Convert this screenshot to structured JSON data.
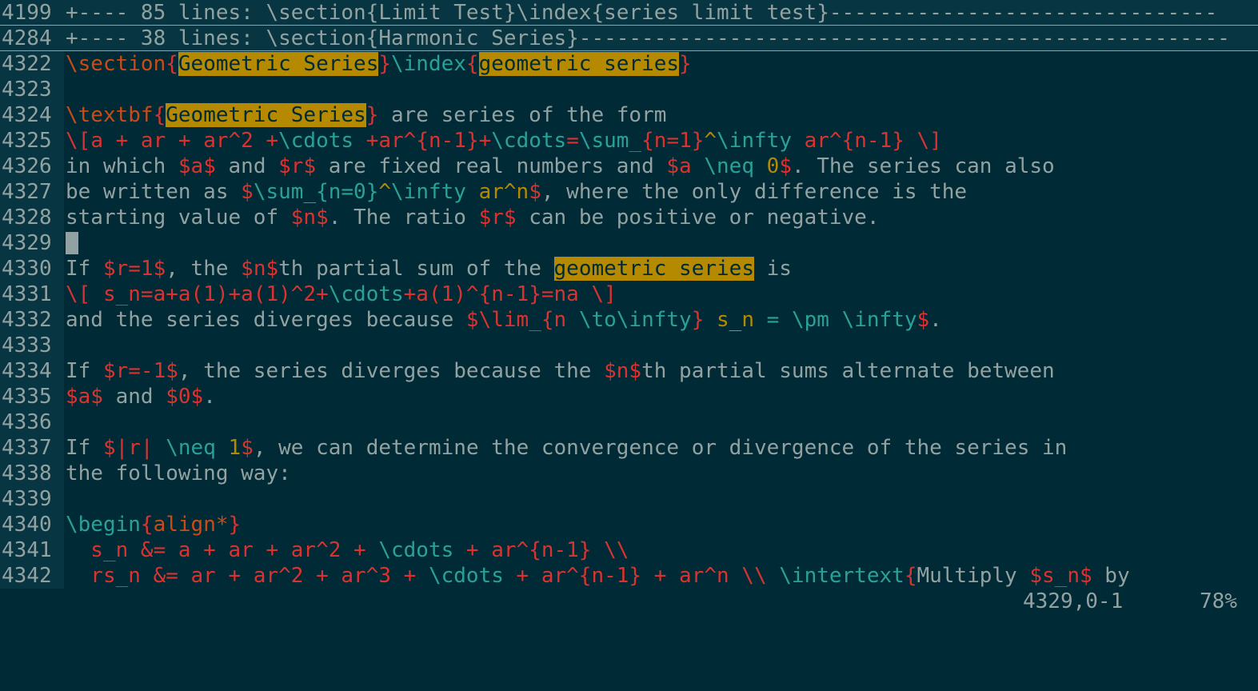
{
  "colors": {
    "background": "#002b36",
    "gutter": "#073642",
    "text": "#93a1a1",
    "red": "#dc322f",
    "cyan": "#2aa198",
    "orange": "#cb4b16",
    "yellow": "#b58900",
    "search_highlight": "#b58900"
  },
  "lines": [
    {
      "num": "4199",
      "fold": true,
      "segs": [
        {
          "t": "+---- 85 lines: \\section{Limit Test}\\index{series limit test}-------------------------------",
          "c": "fold"
        }
      ]
    },
    {
      "num": "4284",
      "fold": true,
      "segs": [
        {
          "t": "+---- 38 lines: \\section{Harmonic Series}----------------------------------------------------",
          "c": "fold"
        }
      ]
    },
    {
      "num": "4322",
      "segs": [
        {
          "t": "\\section",
          "c": "orange"
        },
        {
          "t": "{",
          "c": "red"
        },
        {
          "t": "Geometric Series",
          "c": "hl"
        },
        {
          "t": "}",
          "c": "red"
        },
        {
          "t": "\\index",
          "c": "cyan"
        },
        {
          "t": "{",
          "c": "red"
        },
        {
          "t": "geometric series",
          "c": "hl"
        },
        {
          "t": "}",
          "c": "red"
        }
      ]
    },
    {
      "num": "4323",
      "segs": []
    },
    {
      "num": "4324",
      "segs": [
        {
          "t": "\\textbf",
          "c": "orange"
        },
        {
          "t": "{",
          "c": "red"
        },
        {
          "t": "Geometric Series",
          "c": "hl"
        },
        {
          "t": "}",
          "c": "red"
        },
        {
          "t": " are series of the form",
          "c": "text"
        }
      ]
    },
    {
      "num": "4325",
      "segs": [
        {
          "t": "\\[",
          "c": "red"
        },
        {
          "t": "a + ar + ar^2 +",
          "c": "red"
        },
        {
          "t": "\\cdots",
          "c": "cyan"
        },
        {
          "t": " +ar^",
          "c": "red"
        },
        {
          "t": "{n-1}",
          "c": "red"
        },
        {
          "t": "+",
          "c": "red"
        },
        {
          "t": "\\cdots",
          "c": "cyan"
        },
        {
          "t": "=",
          "c": "red"
        },
        {
          "t": "\\sum",
          "c": "cyan"
        },
        {
          "t": "_{n=1}",
          "c": "red"
        },
        {
          "t": "^",
          "c": "yellow"
        },
        {
          "t": "\\infty",
          "c": "cyan"
        },
        {
          "t": " ar^",
          "c": "red"
        },
        {
          "t": "{n-1}",
          "c": "red"
        },
        {
          "t": " \\]",
          "c": "red"
        }
      ]
    },
    {
      "num": "4326",
      "segs": [
        {
          "t": "in which ",
          "c": "text"
        },
        {
          "t": "$a$",
          "c": "red"
        },
        {
          "t": " and ",
          "c": "text"
        },
        {
          "t": "$r$",
          "c": "red"
        },
        {
          "t": " are fixed real numbers and ",
          "c": "text"
        },
        {
          "t": "$a ",
          "c": "red"
        },
        {
          "t": "\\neq",
          "c": "cyan"
        },
        {
          "t": " 0",
          "c": "yellow"
        },
        {
          "t": "$",
          "c": "red"
        },
        {
          "t": ". The series can also",
          "c": "text"
        }
      ]
    },
    {
      "num": "4327",
      "segs": [
        {
          "t": "be written as ",
          "c": "text"
        },
        {
          "t": "$",
          "c": "red"
        },
        {
          "t": "\\sum",
          "c": "cyan"
        },
        {
          "t": "_{n=0}",
          "c": "cyan"
        },
        {
          "t": "^",
          "c": "yellow"
        },
        {
          "t": "\\infty",
          "c": "cyan"
        },
        {
          "t": " ar^n",
          "c": "yellow"
        },
        {
          "t": "$",
          "c": "red"
        },
        {
          "t": ", where the only difference is the",
          "c": "text"
        }
      ]
    },
    {
      "num": "4328",
      "segs": [
        {
          "t": "starting value of ",
          "c": "text"
        },
        {
          "t": "$n$",
          "c": "red"
        },
        {
          "t": ". The ratio ",
          "c": "text"
        },
        {
          "t": "$r$",
          "c": "red"
        },
        {
          "t": " can be positive or negative.",
          "c": "text"
        }
      ]
    },
    {
      "num": "4329",
      "cursor": true,
      "segs": []
    },
    {
      "num": "4330",
      "segs": [
        {
          "t": "If ",
          "c": "text"
        },
        {
          "t": "$r=1$",
          "c": "red"
        },
        {
          "t": ", the ",
          "c": "text"
        },
        {
          "t": "$n$",
          "c": "red"
        },
        {
          "t": "th partial sum of the ",
          "c": "text"
        },
        {
          "t": "geometric series",
          "c": "hl"
        },
        {
          "t": " is",
          "c": "text"
        }
      ]
    },
    {
      "num": "4331",
      "segs": [
        {
          "t": "\\[ s_n=a+a(1)+a(1)^2+",
          "c": "red"
        },
        {
          "t": "\\cdots",
          "c": "cyan"
        },
        {
          "t": "+a(1)^",
          "c": "red"
        },
        {
          "t": "{n-1}",
          "c": "red"
        },
        {
          "t": "=na \\]",
          "c": "red"
        }
      ]
    },
    {
      "num": "4332",
      "segs": [
        {
          "t": "and the series diverges because ",
          "c": "text"
        },
        {
          "t": "$",
          "c": "red"
        },
        {
          "t": "\\lim",
          "c": "red"
        },
        {
          "t": "_{n ",
          "c": "red"
        },
        {
          "t": "\\to",
          "c": "cyan"
        },
        {
          "t": "\\infty",
          "c": "cyan"
        },
        {
          "t": "}",
          "c": "red"
        },
        {
          "t": " s_n",
          "c": "yellow"
        },
        {
          "t": " = ",
          "c": "cyan"
        },
        {
          "t": "\\pm",
          "c": "cyan"
        },
        {
          "t": " ",
          "c": "text"
        },
        {
          "t": "\\infty",
          "c": "cyan"
        },
        {
          "t": "$",
          "c": "red"
        },
        {
          "t": ".",
          "c": "text"
        }
      ]
    },
    {
      "num": "4333",
      "segs": []
    },
    {
      "num": "4334",
      "segs": [
        {
          "t": "If ",
          "c": "text"
        },
        {
          "t": "$r=-1$",
          "c": "red"
        },
        {
          "t": ", the series diverges because the ",
          "c": "text"
        },
        {
          "t": "$n$",
          "c": "red"
        },
        {
          "t": "th partial sums alternate between",
          "c": "text"
        }
      ]
    },
    {
      "num": "4335",
      "segs": [
        {
          "t": "$a$",
          "c": "red"
        },
        {
          "t": " and ",
          "c": "text"
        },
        {
          "t": "$0$",
          "c": "red"
        },
        {
          "t": ".",
          "c": "text"
        }
      ]
    },
    {
      "num": "4336",
      "segs": []
    },
    {
      "num": "4337",
      "segs": [
        {
          "t": "If ",
          "c": "text"
        },
        {
          "t": "$|r| ",
          "c": "red"
        },
        {
          "t": "\\neq",
          "c": "cyan"
        },
        {
          "t": " 1",
          "c": "yellow"
        },
        {
          "t": "$",
          "c": "red"
        },
        {
          "t": ", we can determine the convergence or divergence of the series in",
          "c": "text"
        }
      ]
    },
    {
      "num": "4338",
      "segs": [
        {
          "t": "the following way:",
          "c": "text"
        }
      ]
    },
    {
      "num": "4339",
      "segs": []
    },
    {
      "num": "4340",
      "segs": [
        {
          "t": "\\begin",
          "c": "cyan"
        },
        {
          "t": "{",
          "c": "red"
        },
        {
          "t": "align*",
          "c": "orange"
        },
        {
          "t": "}",
          "c": "red"
        }
      ]
    },
    {
      "num": "4341",
      "segs": [
        {
          "t": "  s_n &= a + ar + ar^2 + ",
          "c": "red"
        },
        {
          "t": "\\cdots",
          "c": "cyan"
        },
        {
          "t": " + ar^",
          "c": "red"
        },
        {
          "t": "{n-1}",
          "c": "red"
        },
        {
          "t": " \\\\",
          "c": "red"
        }
      ]
    },
    {
      "num": "4342",
      "segs": [
        {
          "t": "  rs_n &= ar + ar^2 + ar^3 + ",
          "c": "red"
        },
        {
          "t": "\\cdots",
          "c": "cyan"
        },
        {
          "t": " + ar^",
          "c": "red"
        },
        {
          "t": "{n-1}",
          "c": "red"
        },
        {
          "t": " + ar^n \\\\ ",
          "c": "red"
        },
        {
          "t": "\\intertext",
          "c": "cyan"
        },
        {
          "t": "{",
          "c": "red"
        },
        {
          "t": "Multiply ",
          "c": "text"
        },
        {
          "t": "$s_n$",
          "c": "red"
        },
        {
          "t": " by",
          "c": "text"
        }
      ]
    }
  ],
  "status": {
    "position": "4329,0-1",
    "percent": "78%"
  }
}
